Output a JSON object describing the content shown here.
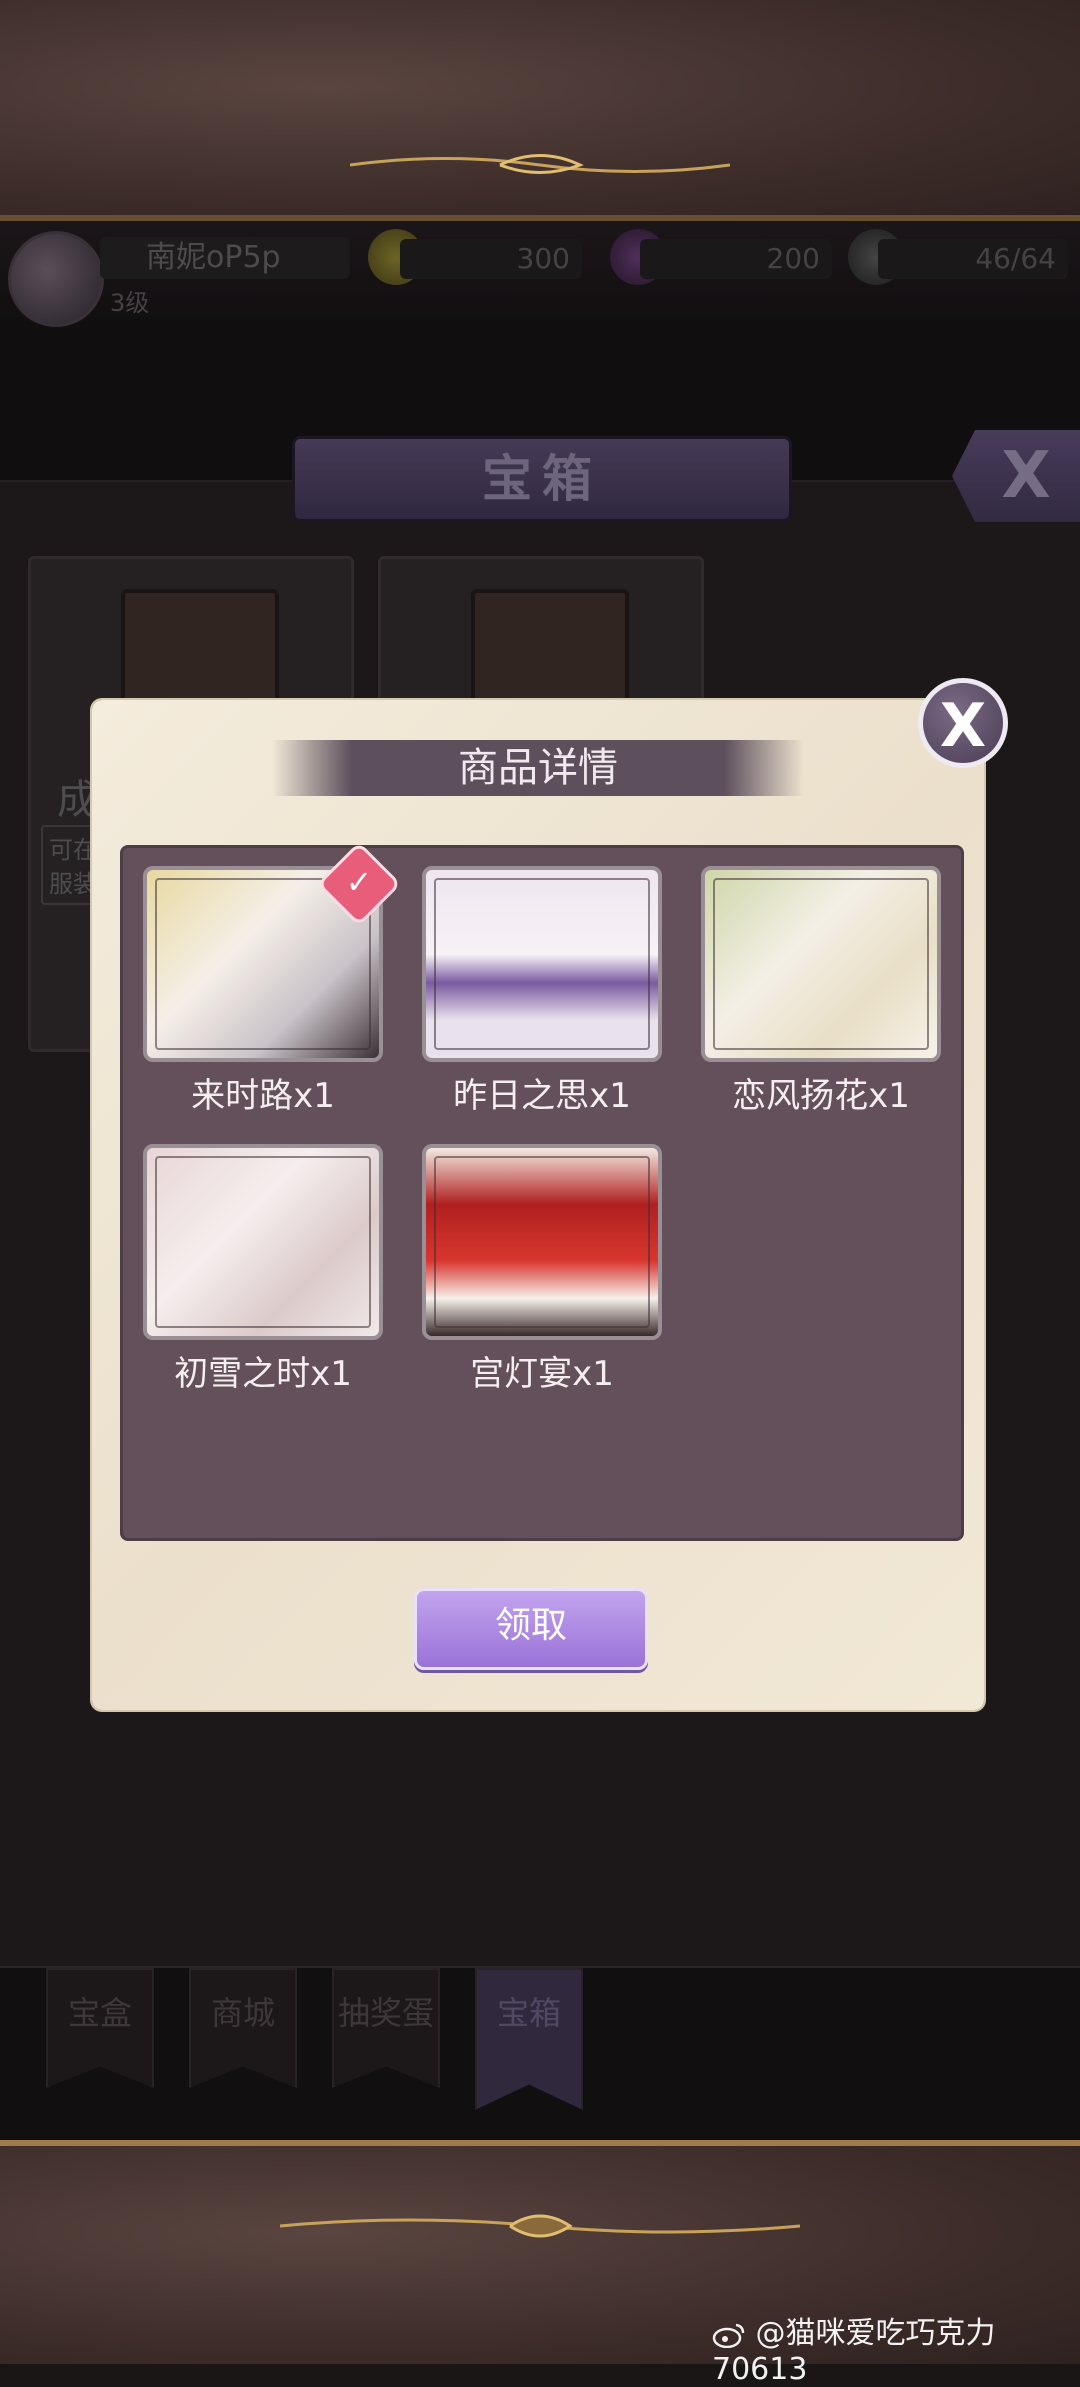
{
  "status": {
    "player_name": "南妮oP5p",
    "player_level": "3级",
    "gold": "300",
    "diamond": "200",
    "stamina": "46/64"
  },
  "panel": {
    "title": "宝箱",
    "close_glyph": "X",
    "chest_card_fragments": [
      "成",
      "可在",
      "服装"
    ]
  },
  "tabs": [
    {
      "label": "宝盒"
    },
    {
      "label": "商城"
    },
    {
      "label": "抽奖蛋"
    },
    {
      "label": "宝箱"
    }
  ],
  "dialog": {
    "title": "商品详情",
    "close_glyph": "X",
    "items": [
      {
        "label": "来时路x1",
        "checked": true
      },
      {
        "label": "昨日之思x1"
      },
      {
        "label": "恋风扬花x1"
      },
      {
        "label": "初雪之时x1"
      },
      {
        "label": "宫灯宴x1"
      }
    ],
    "claim_button": "领取",
    "check_glyph": "✓"
  },
  "watermark": "@猫咪爱吃巧克力70613",
  "colors": {
    "accent_purple": "#9a72d8",
    "dialog_bg": "#f2e8d6",
    "item_area": "#63505a",
    "badge_pink": "#e85e7a"
  }
}
